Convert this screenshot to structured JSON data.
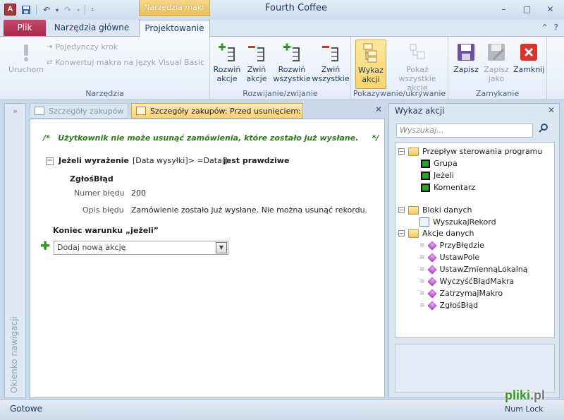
{
  "window": {
    "title": "Fourth Coffee",
    "context_tab": "Narzędzia makr",
    "app_icon": "A",
    "controls": [
      "–",
      "□",
      "✕"
    ]
  },
  "ribbon": {
    "tabs": [
      "Plik",
      "Narzędzia główne",
      "Projektowanie"
    ],
    "active_tab": "Projektowanie",
    "groups": {
      "narzedzia": {
        "label": "Narzędzia",
        "run": "Uruchom",
        "single_step": "Pojedynczy krok",
        "convert": "Konwertuj makra na język Visual Basic"
      },
      "rozwijanie": {
        "label": "Rozwijanie/zwijanie",
        "expand_action_1": "Rozwiń",
        "expand_action_2": "akcje",
        "collapse_action_1": "Zwiń",
        "collapse_action_2": "akcje",
        "expand_all_1": "Rozwiń",
        "expand_all_2": "wszystkie",
        "collapse_all_1": "Zwiń",
        "collapse_all_2": "wszystkie"
      },
      "pokazywanie": {
        "label": "Pokazywanie/ukrywanie",
        "catalog_1": "Wykaz",
        "catalog_2": "akcji",
        "show_all_1": "Pokaż",
        "show_all_2": "wszystkie akcje"
      },
      "zamykanie": {
        "label": "Zamykanie",
        "save": "Zapisz",
        "save_as_1": "Zapisz",
        "save_as_2": "jako",
        "close": "Zamknij"
      }
    }
  },
  "nav_pane": {
    "label": "Okienko nawigacji",
    "chevron": "»"
  },
  "doc_tabs": {
    "inactive": "Szczegóły zakupów",
    "active": "Szczegóły zakupów: Przed usunięciem:"
  },
  "macro": {
    "comment": "/*   Użytkownik nie może usunąć zamówienia, które zostało już wysłane.     */",
    "if_keyword": "Jeżeli wyrażenie",
    "if_condition": "[Data wysyłki]> =Data()",
    "if_then": "jest prawdziwe",
    "action_name": "ZgłośBłąd",
    "error_number_label": "Numer błędu",
    "error_number_value": "200",
    "error_desc_label": "Opis błędu",
    "error_desc_value": "Zamówienie zostało już wysłane. Nie można usunąć rekordu.",
    "end_if": "Koniec warunku „jeżeli”",
    "add_action_value": "Dodaj nową akcję"
  },
  "catalog": {
    "title": "Wykaz akcji",
    "search_placeholder": "Wyszukaj...",
    "flow_folder": "Przepływ sterowania programu",
    "flow_items": [
      "Grupa",
      "Jeżeli",
      "Komentarz"
    ],
    "blocks_folder": "Bloki danych",
    "blocks_items": [
      "WyszukajRekord"
    ],
    "data_actions_folder": "Akcje danych",
    "data_actions_items": [
      "PrzyBłędzie",
      "UstawPole",
      "UstawZmiennąLokalną",
      "WyczyśćBłądMakra",
      "ZatrzymajMakro",
      "ZgłośBłąd"
    ]
  },
  "status": {
    "left": "Gotowe",
    "right": "Num Lock"
  },
  "watermark": {
    "part1": "pliki",
    "part2": ".pl"
  },
  "colors": {
    "file_tab": "#b3355a",
    "context_tab": "#e9bf58",
    "active_doc_tab": "#f5d27a",
    "comment_text": "#2b7a18"
  }
}
